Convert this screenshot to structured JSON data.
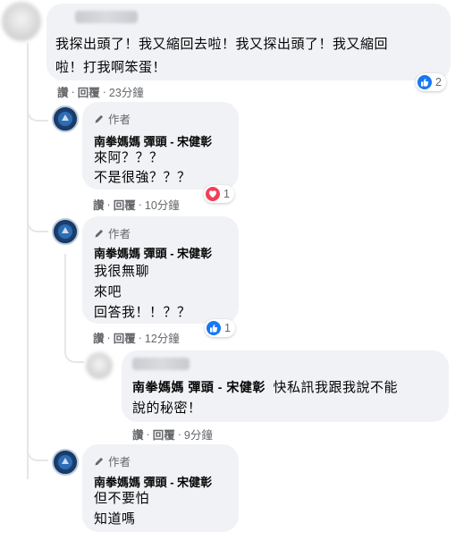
{
  "top_comment": {
    "text_lines": [
      "我探出頭了！我又縮回去啦！我又探出頭了！我又縮回",
      "啦！打我啊笨蛋！"
    ],
    "actions": [
      "讚",
      "回覆",
      "23分鐘"
    ],
    "reaction": {
      "icon": "like-icon",
      "count": "2",
      "color": "#1877f2"
    }
  },
  "replies": [
    {
      "badge": "作者",
      "name": "南拳媽媽 彈頭 - 宋健彰",
      "lines": [
        "來阿？？？",
        "不是很強？？？"
      ],
      "actions": [
        "讚",
        "回覆",
        "10分鐘"
      ],
      "reaction": {
        "icon": "love-icon",
        "count": "1",
        "color": "#f33e58"
      }
    },
    {
      "badge": "作者",
      "name": "南拳媽媽 彈頭 - 宋健彰",
      "lines": [
        "我很無聊",
        "來吧",
        "回答我！！？？"
      ],
      "actions": [
        "讚",
        "回覆",
        "12分鐘"
      ],
      "reaction": {
        "icon": "like-icon",
        "count": "1",
        "color": "#1877f2"
      }
    },
    {
      "badge": "作者",
      "name": "南拳媽媽 彈頭 - 宋健彰",
      "lines": [
        "但不要怕",
        "知道嗎"
      ]
    }
  ],
  "nested_reply": {
    "tag_name": "南拳媽媽 彈頭 - 宋健彰",
    "text_after": "快私訊我跟我說不能",
    "text_line2": "說的秘密！",
    "actions": [
      "讚",
      "回覆",
      "9分鐘"
    ]
  },
  "colors": {
    "bubble": "#f0f2f5",
    "meta_text": "#65676b",
    "like_blue": "#1877f2",
    "love_red": "#f33e58"
  }
}
